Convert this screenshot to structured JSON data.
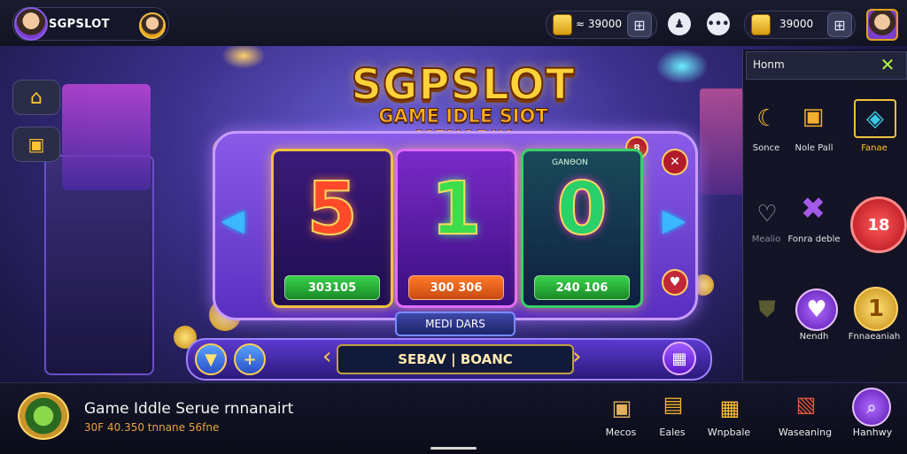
{
  "header": {
    "username": "SGPSLOT",
    "coins_primary": "≈ 39000",
    "coins_secondary": "39000",
    "chat_label": "•••"
  },
  "title": {
    "main": "SGPSLOT",
    "sub": "GAME IDLE SIOT MENARIK"
  },
  "slots": [
    {
      "symbol": "5",
      "button": "303105",
      "color": "#ff4a2a"
    },
    {
      "symbol": "1",
      "button": "300 306",
      "color": "#3ddc4a"
    },
    {
      "symbol": "0",
      "button": "240 106",
      "color": "#2ad06a",
      "tag": "GΑΝΘΟΝ"
    }
  ],
  "reels_label": "MEDI DARS",
  "balance_label": "SEBAV | BOANC",
  "right_panel": {
    "title": "Honm",
    "items": [
      {
        "label": "Sonce",
        "icon": "banana-icon"
      },
      {
        "label": "Nole Pall",
        "icon": "chest-icon"
      },
      {
        "label": "Fanae",
        "icon": "frame-icon"
      },
      {
        "label": "Mealio",
        "icon": "heart-icon"
      },
      {
        "label": "Fonra deble",
        "icon": "cross-icon"
      },
      {
        "label": "18",
        "icon": "red-orb-icon"
      },
      {
        "label": "",
        "icon": "shield-icon"
      },
      {
        "label": "Nendh",
        "icon": "purple-heart-icon"
      },
      {
        "label": "Fnnaeaniah",
        "icon": "gold-coin-icon"
      }
    ]
  },
  "bottom": {
    "game_name": "Game Iddle Serue rnnanairt",
    "game_sub": "30F 40.350 tnnane 56fne",
    "nav": [
      {
        "label": "Mecos",
        "icon": "box-icon"
      },
      {
        "label": "Eales",
        "icon": "gift-icon"
      },
      {
        "label": "Wnpbale",
        "icon": "treasure-icon"
      },
      {
        "label": "Waseaning",
        "icon": "ticket-icon"
      },
      {
        "label": "Hanhwy",
        "icon": "search-icon"
      }
    ]
  },
  "colors": {
    "accent": "#8a5be8",
    "gold": "#ffd23a",
    "background": "#1b1846"
  }
}
